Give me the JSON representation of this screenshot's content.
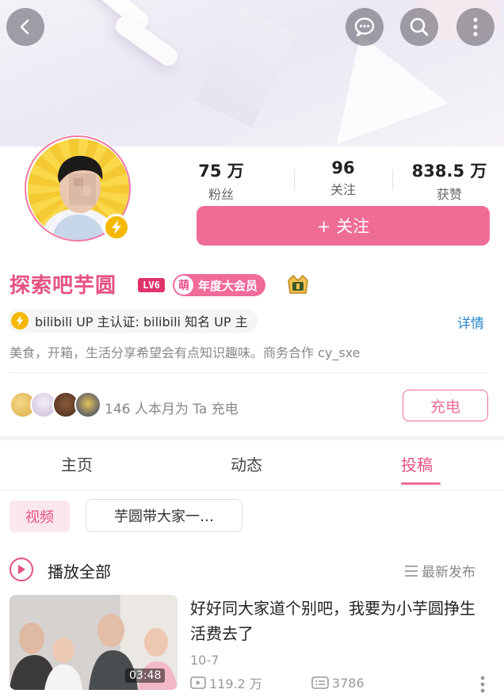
{
  "profile": {
    "name": "探索吧芋圆",
    "level": "LV6",
    "vip_icon_char": "萌",
    "vip_label": "年度大会员",
    "verification": "bilibili UP 主认证: bilibili 知名 UP 主",
    "details_label": "详情",
    "bio": "美食，开箱，生活分享希望会有点知识趣味。商务合作 cy_sxe"
  },
  "stats": {
    "fans_num": "75 万",
    "fans_label": "粉丝",
    "following_num": "96",
    "following_label": "关注",
    "likes_num": "838.5 万",
    "likes_label": "获赞"
  },
  "follow_label": "+ 关注",
  "charge": {
    "text": "146 人本月为 Ta 充电",
    "button": "充电"
  },
  "tabs": [
    "主页",
    "动态",
    "投稿"
  ],
  "active_tab": "投稿",
  "filters": {
    "video": "视频",
    "series": "芋圆带大家一…"
  },
  "play_all_label": "播放全部",
  "sort_label": "最新发布",
  "video": {
    "title": "好好同大家道个别吧，我要为小芋圆挣生活费去了",
    "date": "10-7",
    "plays": "119.2 万",
    "comments": "3786",
    "duration": "03:48"
  },
  "colors": {
    "accent": "#ef6d95",
    "link": "#2a86c9",
    "badge": "#f5b800"
  },
  "icons": [
    "back-arrow-icon",
    "chat-bubble-icon",
    "search-icon",
    "more-vertical-icon",
    "lightning-icon",
    "play-circle-icon",
    "sort-icon",
    "play-count-icon",
    "comment-count-icon"
  ]
}
